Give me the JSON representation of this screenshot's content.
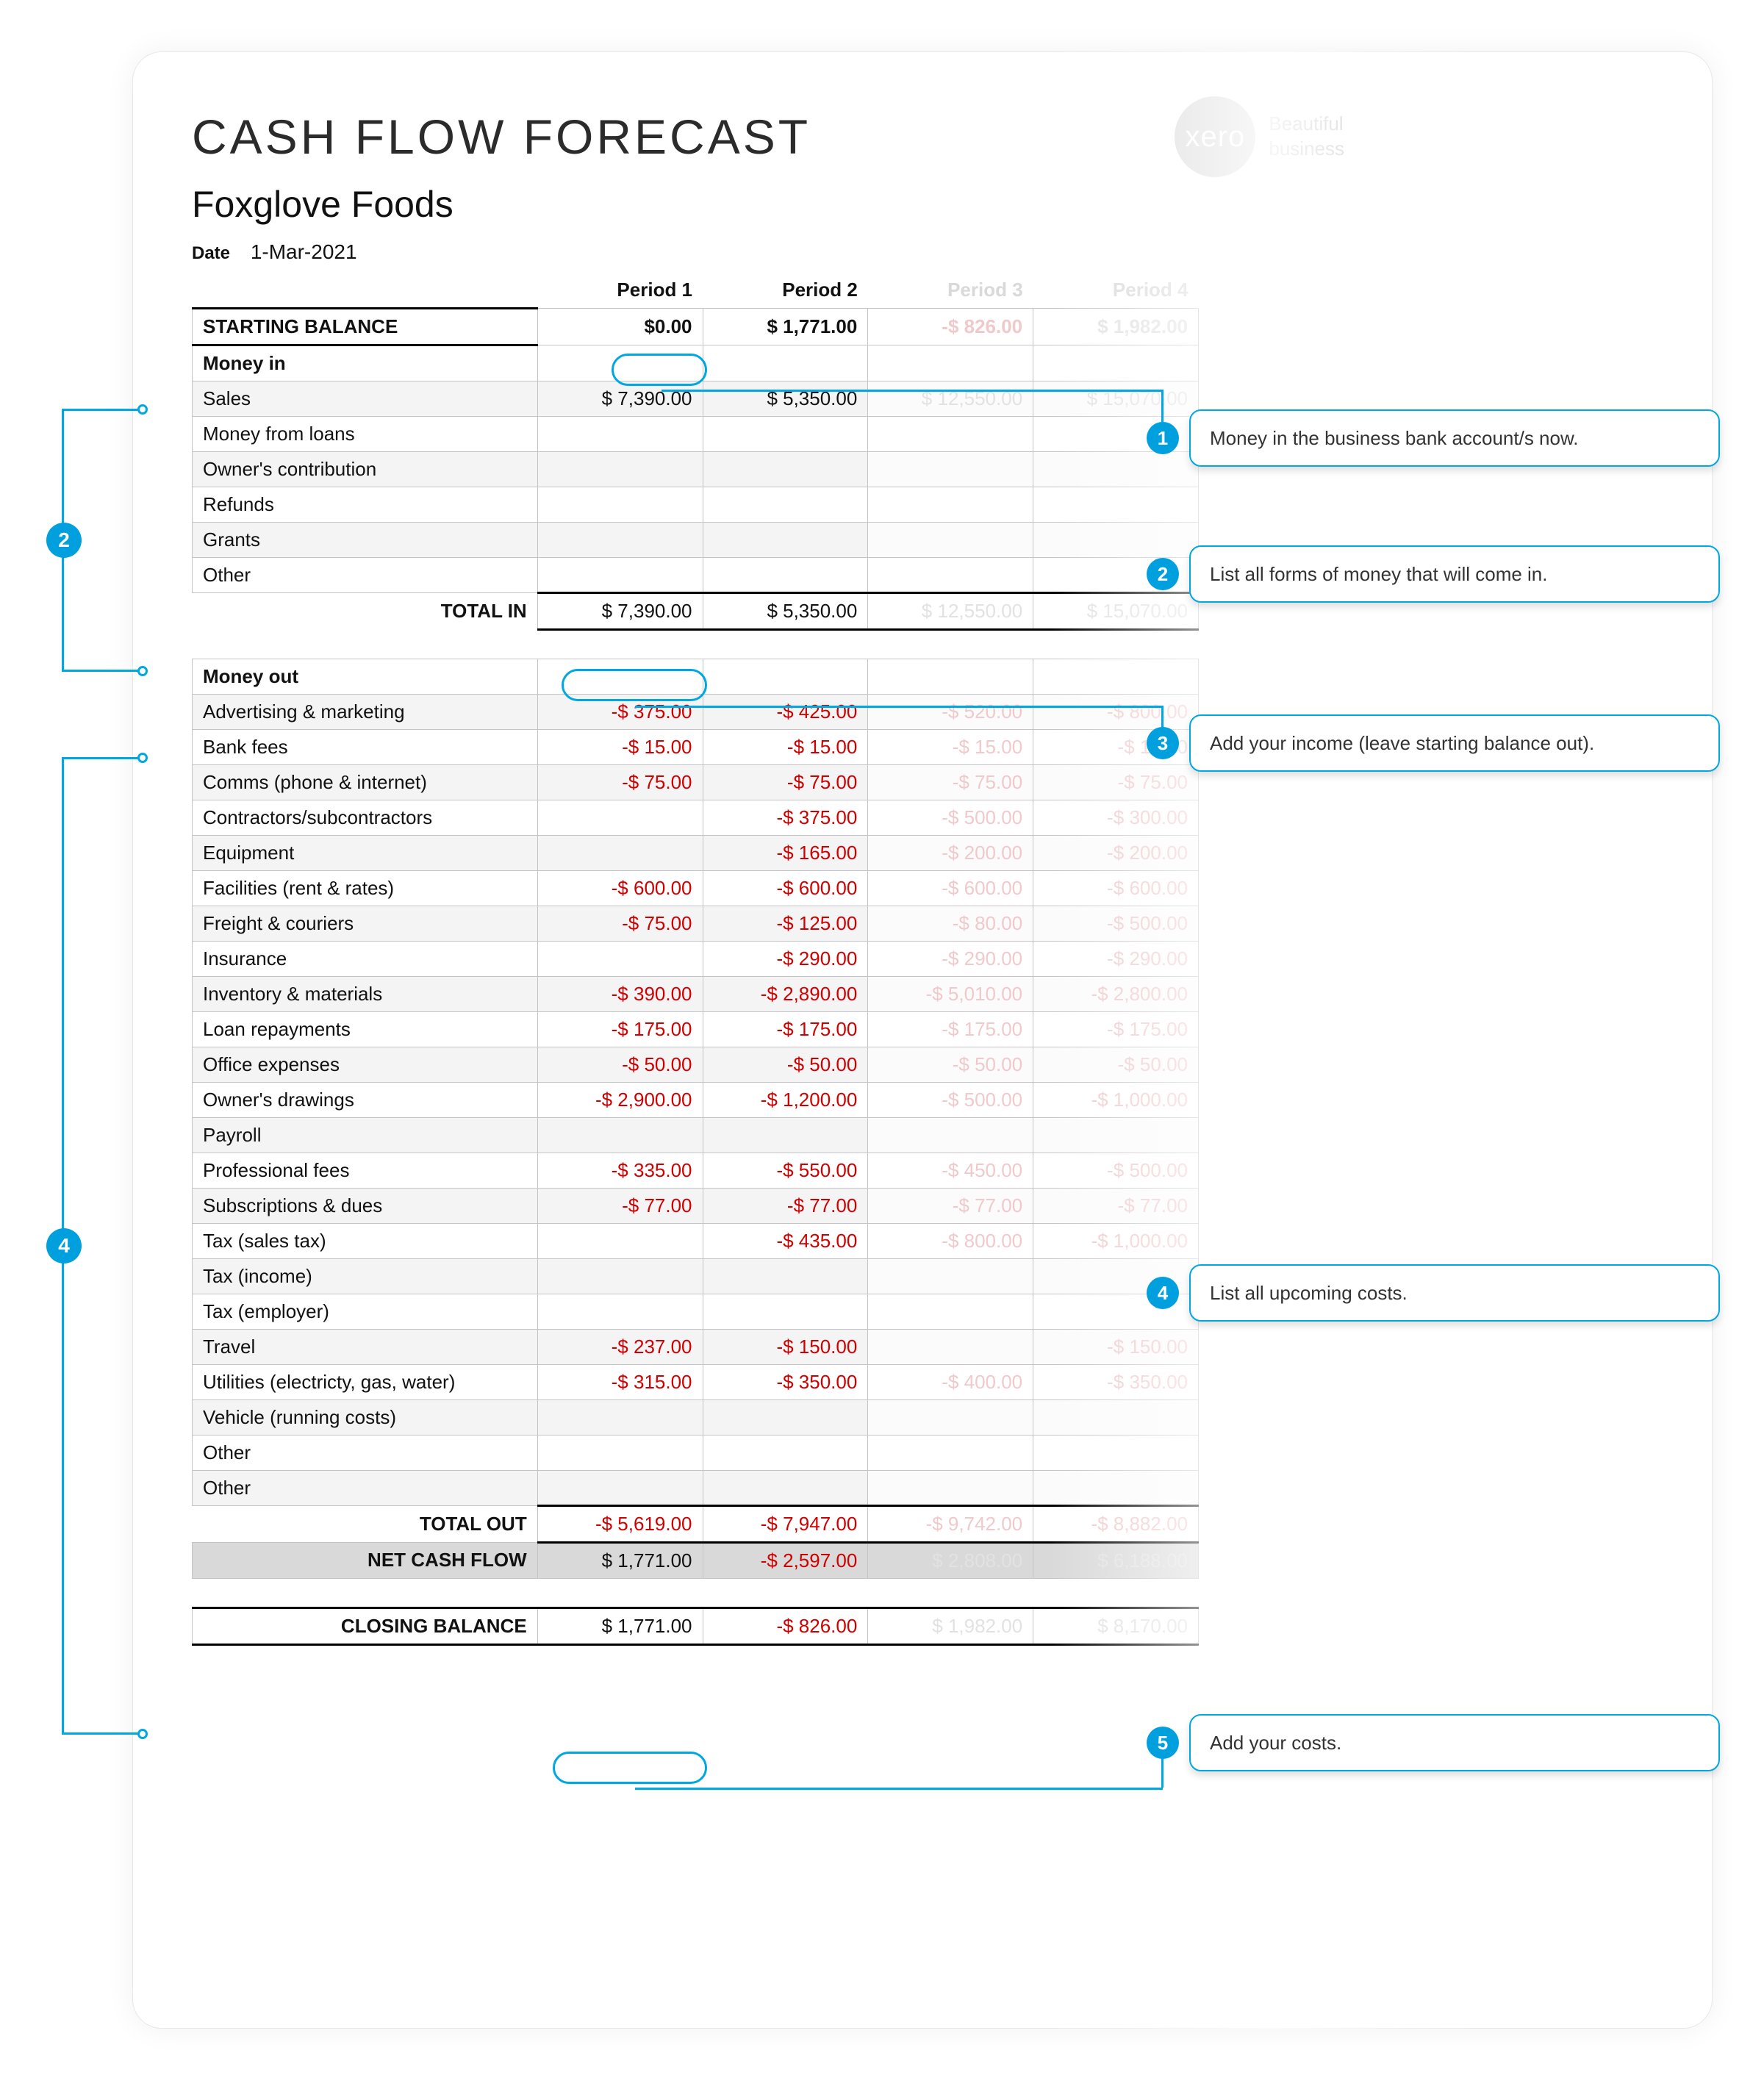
{
  "title": "CASH FLOW FORECAST",
  "company": "Foxglove Foods",
  "date_label": "Date",
  "date_value": "1-Mar-2021",
  "brand": {
    "name": "xero",
    "tagline1": "Beautiful",
    "tagline2": "business"
  },
  "periods": [
    "Period 1",
    "Period 2",
    "Period 3",
    "Period 4"
  ],
  "starting_balance": {
    "label": "STARTING BALANCE",
    "values": [
      "$0.00",
      "$ 1,771.00",
      "-$ 826.00",
      "$ 1,982.00"
    ]
  },
  "money_in": {
    "heading": "Money in",
    "rows": [
      {
        "label": "Sales",
        "values": [
          "$ 7,390.00",
          "$ 5,350.00",
          "$ 12,550.00",
          "$ 15,070.00"
        ]
      },
      {
        "label": "Money from loans",
        "values": [
          "",
          "",
          "",
          ""
        ]
      },
      {
        "label": "Owner's contribution",
        "values": [
          "",
          "",
          "",
          ""
        ]
      },
      {
        "label": "Refunds",
        "values": [
          "",
          "",
          "",
          ""
        ]
      },
      {
        "label": "Grants",
        "values": [
          "",
          "",
          "",
          ""
        ]
      },
      {
        "label": "Other",
        "values": [
          "",
          "",
          "",
          ""
        ]
      }
    ],
    "total": {
      "label": "TOTAL IN",
      "values": [
        "$ 7,390.00",
        "$ 5,350.00",
        "$ 12,550.00",
        "$ 15,070.00"
      ]
    }
  },
  "money_out": {
    "heading": "Money out",
    "rows": [
      {
        "label": "Advertising & marketing",
        "values": [
          "-$ 375.00",
          "-$ 425.00",
          "-$ 520.00",
          "-$ 800.00"
        ]
      },
      {
        "label": "Bank fees",
        "values": [
          "-$ 15.00",
          "-$ 15.00",
          "-$ 15.00",
          "-$ 15.00"
        ]
      },
      {
        "label": "Comms (phone & internet)",
        "values": [
          "-$ 75.00",
          "-$ 75.00",
          "-$ 75.00",
          "-$ 75.00"
        ]
      },
      {
        "label": "Contractors/subcontractors",
        "values": [
          "",
          "-$ 375.00",
          "-$ 500.00",
          "-$ 300.00"
        ]
      },
      {
        "label": "Equipment",
        "values": [
          "",
          "-$ 165.00",
          "-$ 200.00",
          "-$ 200.00"
        ]
      },
      {
        "label": "Facilities (rent & rates)",
        "values": [
          "-$ 600.00",
          "-$ 600.00",
          "-$ 600.00",
          "-$ 600.00"
        ]
      },
      {
        "label": "Freight & couriers",
        "values": [
          "-$ 75.00",
          "-$ 125.00",
          "-$ 80.00",
          "-$ 500.00"
        ]
      },
      {
        "label": "Insurance",
        "values": [
          "",
          "-$ 290.00",
          "-$ 290.00",
          "-$ 290.00"
        ]
      },
      {
        "label": "Inventory & materials",
        "values": [
          "-$ 390.00",
          "-$ 2,890.00",
          "-$ 5,010.00",
          "-$ 2,800.00"
        ]
      },
      {
        "label": "Loan repayments",
        "values": [
          "-$ 175.00",
          "-$ 175.00",
          "-$ 175.00",
          "-$ 175.00"
        ]
      },
      {
        "label": "Office expenses",
        "values": [
          "-$ 50.00",
          "-$ 50.00",
          "-$ 50.00",
          "-$ 50.00"
        ]
      },
      {
        "label": "Owner's drawings",
        "values": [
          "-$ 2,900.00",
          "-$ 1,200.00",
          "-$ 500.00",
          "-$ 1,000.00"
        ]
      },
      {
        "label": "Payroll",
        "values": [
          "",
          "",
          "",
          ""
        ]
      },
      {
        "label": "Professional fees",
        "values": [
          "-$ 335.00",
          "-$ 550.00",
          "-$ 450.00",
          "-$ 500.00"
        ]
      },
      {
        "label": "Subscriptions & dues",
        "values": [
          "-$ 77.00",
          "-$ 77.00",
          "-$ 77.00",
          "-$ 77.00"
        ]
      },
      {
        "label": "Tax (sales tax)",
        "values": [
          "",
          "-$ 435.00",
          "-$ 800.00",
          "-$ 1,000.00"
        ]
      },
      {
        "label": "Tax (income)",
        "values": [
          "",
          "",
          "",
          ""
        ]
      },
      {
        "label": "Tax (employer)",
        "values": [
          "",
          "",
          "",
          ""
        ]
      },
      {
        "label": "Travel",
        "values": [
          "-$ 237.00",
          "-$ 150.00",
          "",
          "-$ 150.00"
        ]
      },
      {
        "label": "Utilities (electricty, gas, water)",
        "values": [
          "-$ 315.00",
          "-$ 350.00",
          "-$ 400.00",
          "-$ 350.00"
        ]
      },
      {
        "label": "Vehicle (running costs)",
        "values": [
          "",
          "",
          "",
          ""
        ]
      },
      {
        "label": "Other",
        "values": [
          "",
          "",
          "",
          ""
        ]
      },
      {
        "label": "Other",
        "values": [
          "",
          "",
          "",
          ""
        ]
      }
    ],
    "total": {
      "label": "TOTAL OUT",
      "values": [
        "-$ 5,619.00",
        "-$ 7,947.00",
        "-$ 9,742.00",
        "-$ 8,882.00"
      ]
    }
  },
  "net": {
    "label": "NET CASH FLOW",
    "values": [
      "$ 1,771.00",
      "-$ 2,597.00",
      "$ 2,808.00",
      "$ 6,188.00"
    ]
  },
  "closing": {
    "label": "CLOSING BALANCE",
    "values": [
      "$ 1,771.00",
      "-$ 826.00",
      "$ 1,982.00",
      "$ 8,170.00"
    ]
  },
  "callouts": {
    "c1": "Money in the business bank account/s now.",
    "c2": "List all forms of money that will come in.",
    "c3": "Add your income (leave starting balance out).",
    "c4": "List all upcoming costs.",
    "c5": "Add your costs."
  },
  "chart_data": {
    "type": "table",
    "title": "CASH FLOW FORECAST — Foxglove Foods — 1-Mar-2021",
    "columns": [
      "Period 1",
      "Period 2",
      "Period 3",
      "Period 4"
    ],
    "column_visibility": [
      "active",
      "active",
      "faded",
      "faded"
    ],
    "rows": [
      {
        "label": "STARTING BALANCE",
        "values": [
          0.0,
          1771.0,
          -826.0,
          1982.0
        ]
      },
      {
        "label": "Sales",
        "values": [
          7390.0,
          5350.0,
          12550.0,
          15070.0
        ]
      },
      {
        "label": "TOTAL IN",
        "values": [
          7390.0,
          5350.0,
          12550.0,
          15070.0
        ]
      },
      {
        "label": "Advertising & marketing",
        "values": [
          -375.0,
          -425.0,
          -520.0,
          -800.0
        ]
      },
      {
        "label": "Bank fees",
        "values": [
          -15.0,
          -15.0,
          -15.0,
          -15.0
        ]
      },
      {
        "label": "Comms (phone & internet)",
        "values": [
          -75.0,
          -75.0,
          -75.0,
          -75.0
        ]
      },
      {
        "label": "Contractors/subcontractors",
        "values": [
          null,
          -375.0,
          -500.0,
          -300.0
        ]
      },
      {
        "label": "Equipment",
        "values": [
          null,
          -165.0,
          -200.0,
          -200.0
        ]
      },
      {
        "label": "Facilities (rent & rates)",
        "values": [
          -600.0,
          -600.0,
          -600.0,
          -600.0
        ]
      },
      {
        "label": "Freight & couriers",
        "values": [
          -75.0,
          -125.0,
          -80.0,
          -500.0
        ]
      },
      {
        "label": "Insurance",
        "values": [
          null,
          -290.0,
          -290.0,
          -290.0
        ]
      },
      {
        "label": "Inventory & materials",
        "values": [
          -390.0,
          -2890.0,
          -5010.0,
          -2800.0
        ]
      },
      {
        "label": "Loan repayments",
        "values": [
          -175.0,
          -175.0,
          -175.0,
          -175.0
        ]
      },
      {
        "label": "Office expenses",
        "values": [
          -50.0,
          -50.0,
          -50.0,
          -50.0
        ]
      },
      {
        "label": "Owner's drawings",
        "values": [
          -2900.0,
          -1200.0,
          -500.0,
          -1000.0
        ]
      },
      {
        "label": "Payroll",
        "values": [
          null,
          null,
          null,
          null
        ]
      },
      {
        "label": "Professional fees",
        "values": [
          -335.0,
          -550.0,
          -450.0,
          -500.0
        ]
      },
      {
        "label": "Subscriptions & dues",
        "values": [
          -77.0,
          -77.0,
          -77.0,
          -77.0
        ]
      },
      {
        "label": "Tax (sales tax)",
        "values": [
          null,
          -435.0,
          -800.0,
          -1000.0
        ]
      },
      {
        "label": "Tax (income)",
        "values": [
          null,
          null,
          null,
          null
        ]
      },
      {
        "label": "Tax (employer)",
        "values": [
          null,
          null,
          null,
          null
        ]
      },
      {
        "label": "Travel",
        "values": [
          -237.0,
          -150.0,
          null,
          -150.0
        ]
      },
      {
        "label": "Utilities (electricty, gas, water)",
        "values": [
          -315.0,
          -350.0,
          -400.0,
          -350.0
        ]
      },
      {
        "label": "Vehicle (running costs)",
        "values": [
          null,
          null,
          null,
          null
        ]
      },
      {
        "label": "TOTAL OUT",
        "values": [
          -5619.0,
          -7947.0,
          -9742.0,
          -8882.0
        ]
      },
      {
        "label": "NET CASH FLOW",
        "values": [
          1771.0,
          -2597.0,
          2808.0,
          6188.0
        ]
      },
      {
        "label": "CLOSING BALANCE",
        "values": [
          1771.0,
          -826.0,
          1982.0,
          8170.0
        ]
      }
    ]
  }
}
